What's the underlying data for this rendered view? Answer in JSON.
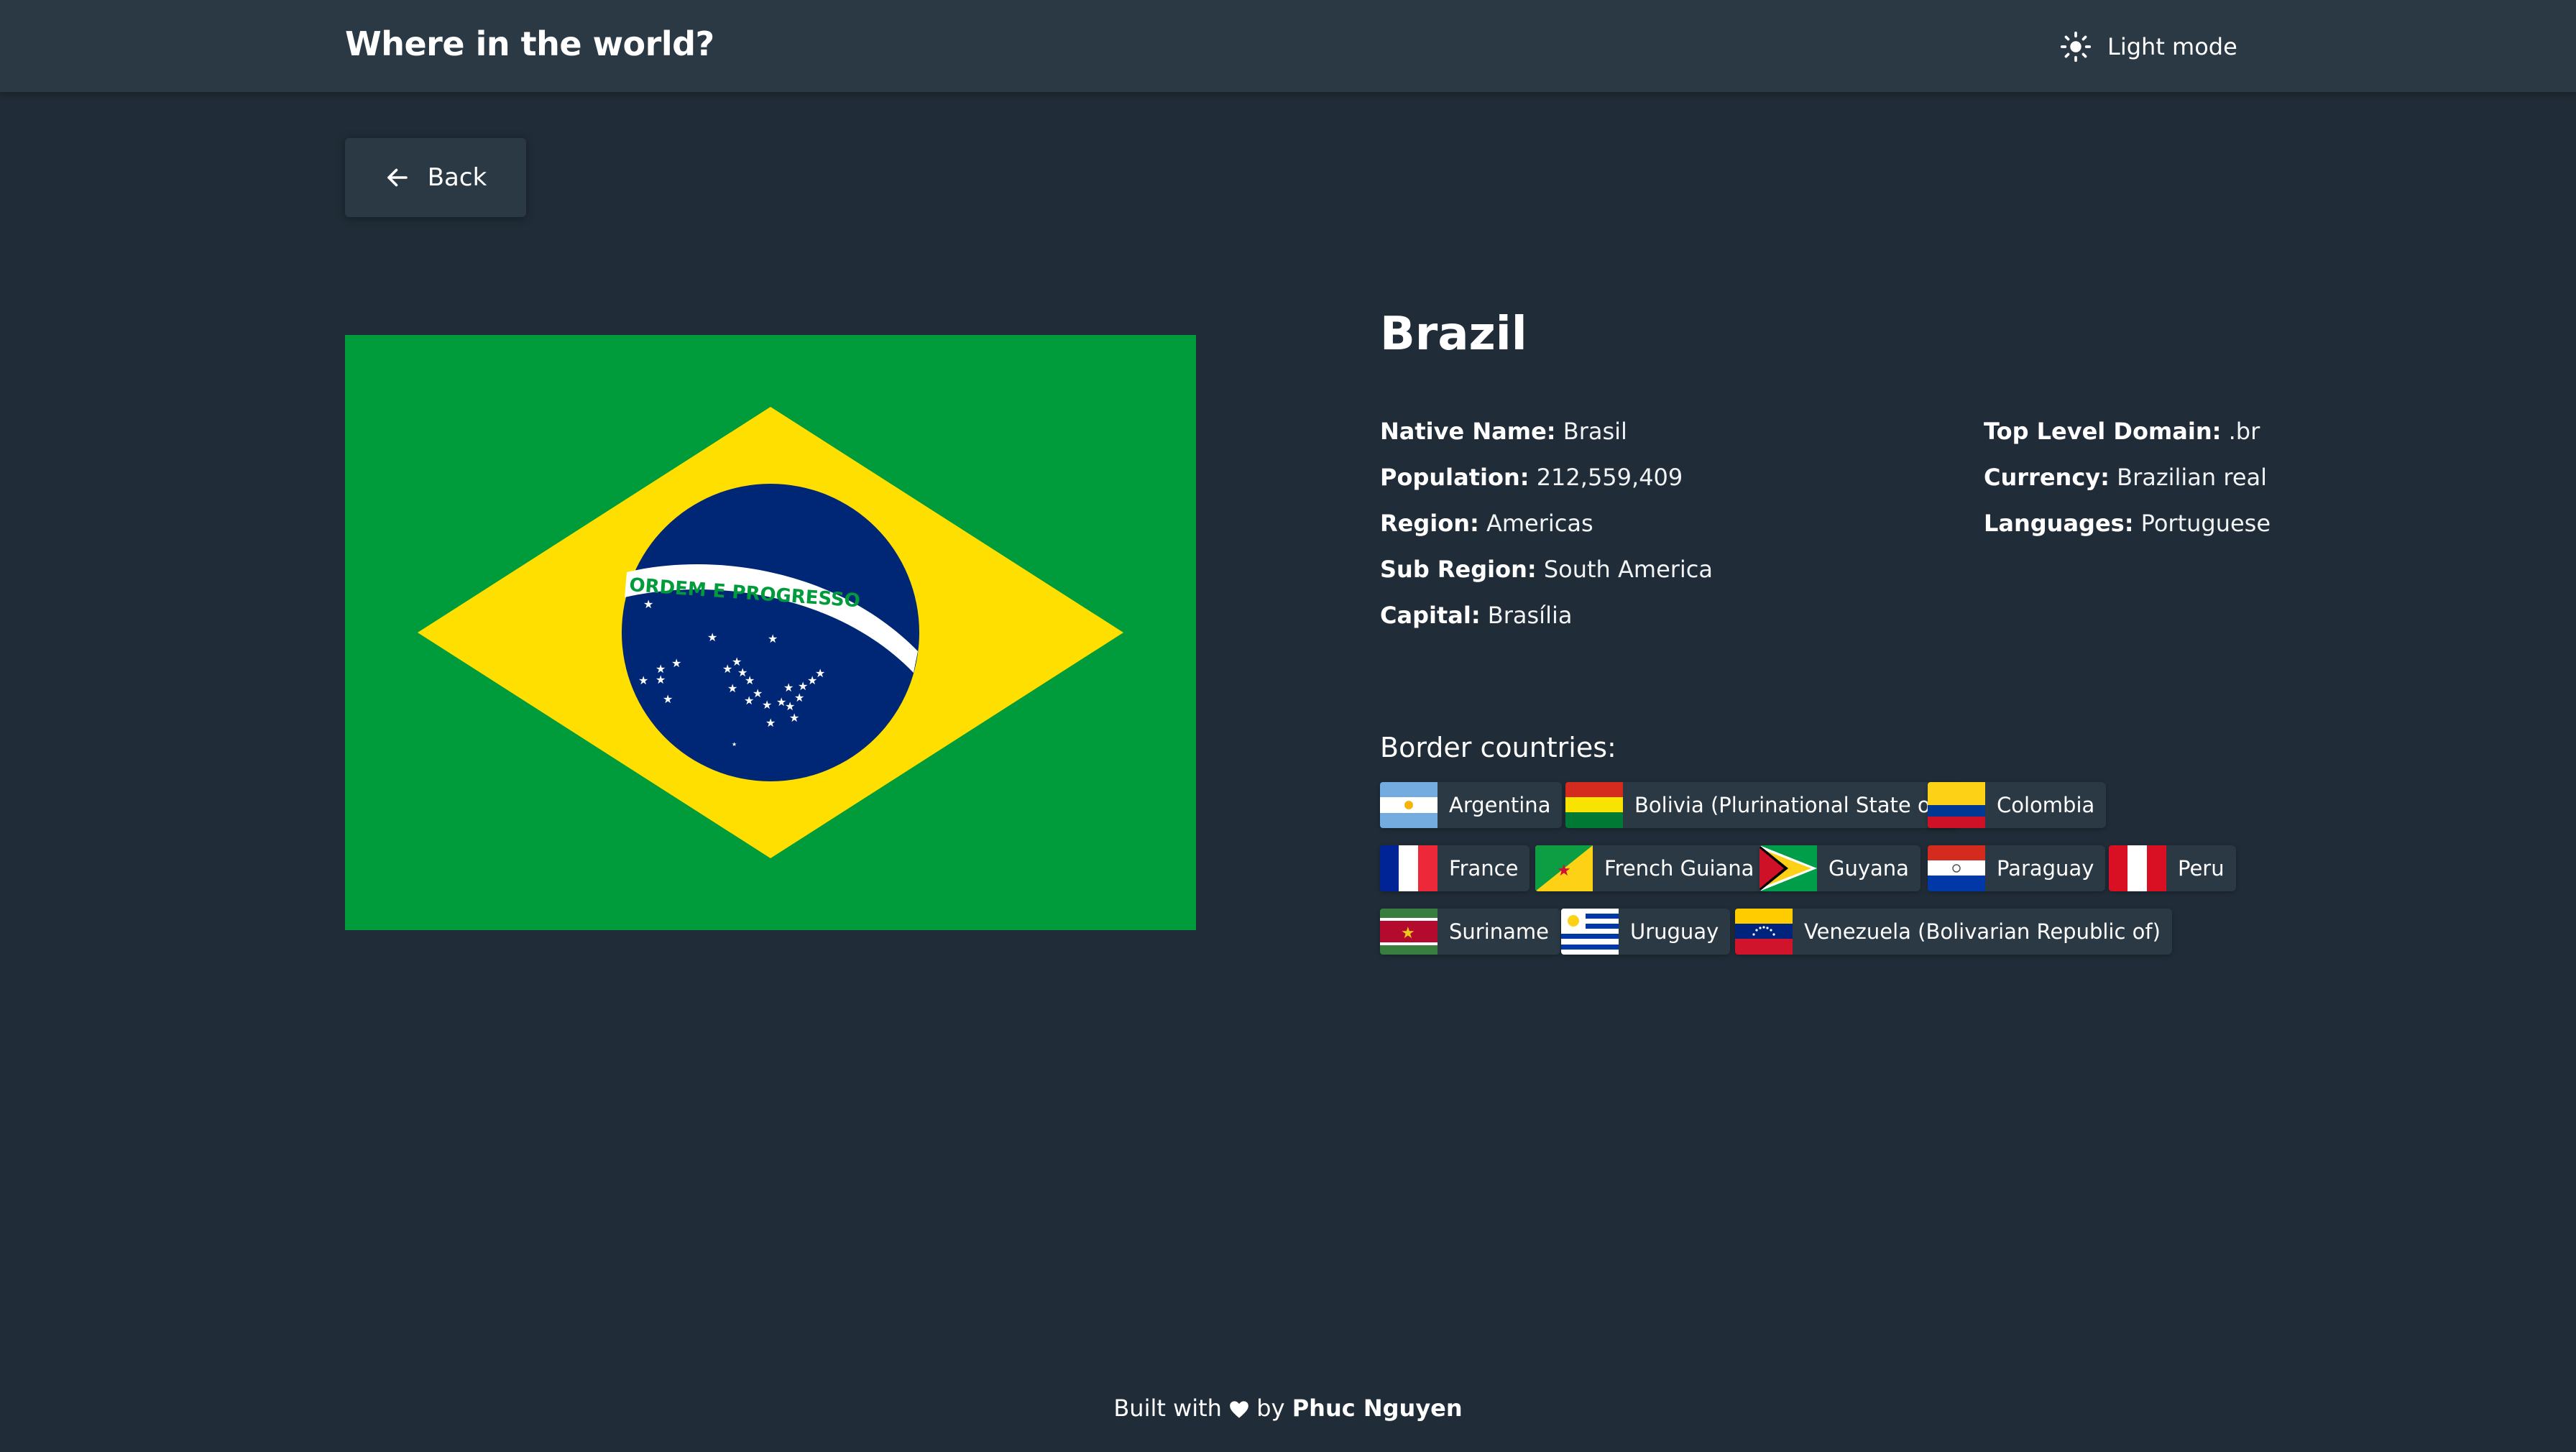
{
  "header": {
    "title": "Where in the world?",
    "theme_toggle_label": "Light mode",
    "theme_icon": "sun-icon"
  },
  "back_button": {
    "label": "Back",
    "icon": "arrow-left-icon"
  },
  "country": {
    "name": "Brazil",
    "flag_motto": "ORDEM E PROGRESSO",
    "info_left": [
      {
        "label": "Native Name:",
        "value": "Brasil"
      },
      {
        "label": "Population:",
        "value": "212,559,409"
      },
      {
        "label": "Region:",
        "value": "Americas"
      },
      {
        "label": "Sub Region:",
        "value": "South America"
      },
      {
        "label": "Capital:",
        "value": "Brasília"
      }
    ],
    "info_right": [
      {
        "label": "Top Level Domain:",
        "value": ".br"
      },
      {
        "label": "Currency:",
        "value": "Brazilian real"
      },
      {
        "label": "Languages:",
        "value": "Portuguese"
      }
    ]
  },
  "border": {
    "heading": "Border countries:",
    "countries": [
      "Argentina",
      "Bolivia (Plurinational State of)",
      "Colombia",
      "France",
      "French Guiana",
      "Guyana",
      "Paraguay",
      "Peru",
      "Suriname",
      "Uruguay",
      "Venezuela (Bolivarian Republic of)"
    ]
  },
  "footer": {
    "prefix": "Built with",
    "middle": "by",
    "author": "Phuc Nguyen",
    "heart_icon": "heart-icon"
  },
  "colors": {
    "background": "#202c37",
    "elements": "#2b3945",
    "text": "#ffffff"
  }
}
